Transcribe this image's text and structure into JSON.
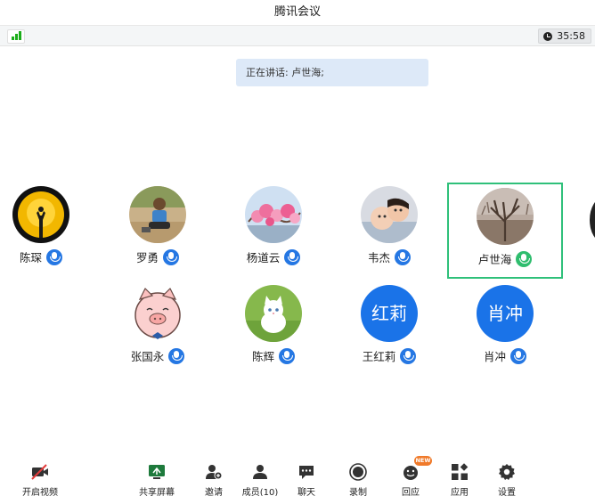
{
  "window": {
    "title": "腾讯会议"
  },
  "infobar": {
    "duration": "35:58"
  },
  "speaking": {
    "text": "正在讲话: 卢世海;"
  },
  "participants": [
    {
      "name": "陈琛",
      "avatar": "yellow-silhouette",
      "mic_color": "#2577e3"
    },
    {
      "name": "罗勇",
      "avatar": "child-photo",
      "mic_color": "#2577e3"
    },
    {
      "name": "杨道云",
      "avatar": "pink-flowers",
      "mic_color": "#2577e3"
    },
    {
      "name": "韦杰",
      "avatar": "babies-photo",
      "mic_color": "#2577e3"
    },
    {
      "name": "卢世海",
      "avatar": "orchard-tree",
      "mic_color": "#2fbd6e",
      "speaking": true
    },
    {
      "name": "张国永",
      "avatar": "pig-cartoon",
      "mic_color": "#2577e3"
    },
    {
      "name": "陈辉",
      "avatar": "white-kitten",
      "mic_color": "#2577e3"
    },
    {
      "name": "王红莉",
      "avatar_text": "红莉",
      "mic_color": "#2577e3"
    },
    {
      "name": "肖冲",
      "avatar_text": "肖冲",
      "mic_color": "#2577e3"
    }
  ],
  "toolbar": {
    "video": "开启视频",
    "share": "共享屏幕",
    "invite": "邀请",
    "members": "成员(10)",
    "chat": "聊天",
    "record": "录制",
    "react": "回应",
    "react_badge": "NEW",
    "apps": "应用",
    "settings": "设置"
  },
  "colors": {
    "accent": "#1a73e8",
    "speaking_border": "#2fc07a",
    "signal": "#1aad19"
  }
}
